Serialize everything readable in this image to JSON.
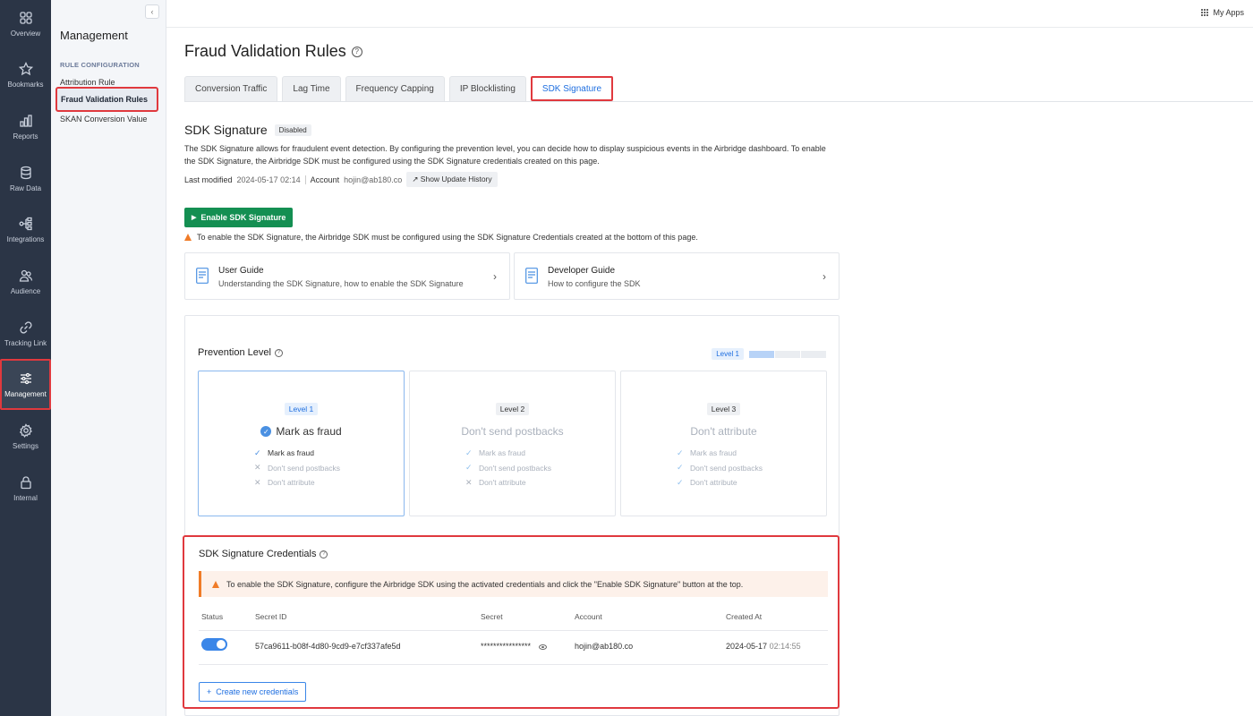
{
  "rail": {
    "items": [
      {
        "label": "Overview",
        "icon": "grid-icon"
      },
      {
        "label": "Bookmarks",
        "icon": "star-icon"
      },
      {
        "label": "Reports",
        "icon": "bar-chart-icon"
      },
      {
        "label": "Raw Data",
        "icon": "database-icon"
      },
      {
        "label": "Integrations",
        "icon": "integrations-icon"
      },
      {
        "label": "Audience",
        "icon": "audience-icon"
      },
      {
        "label": "Tracking Link",
        "icon": "link-icon"
      },
      {
        "label": "Management",
        "icon": "sliders-icon"
      },
      {
        "label": "Settings",
        "icon": "gear-icon"
      },
      {
        "label": "Internal",
        "icon": "lock-icon"
      }
    ]
  },
  "subnav": {
    "collapse": "‹",
    "title": "Management",
    "section": "RULE CONFIGURATION",
    "links": [
      "Attribution Rule",
      "Fraud Validation Rules",
      "SKAN Conversion Value"
    ]
  },
  "topbar": {
    "myapps": "My Apps"
  },
  "page": {
    "title": "Fraud Validation Rules",
    "help": "?"
  },
  "tabs": [
    "Conversion Traffic",
    "Lag Time",
    "Frequency Capping",
    "IP Blocklisting",
    "SDK Signature"
  ],
  "sdk": {
    "title": "SDK Signature",
    "status": "Disabled",
    "description": "The SDK Signature allows for fraudulent event detection. By configuring the prevention level, you can decide how to display suspicious events in the Airbridge dashboard. To enable the SDK Signature, the Airbridge SDK must be configured using the SDK Signature credentials created on this page.",
    "last_modified_label": "Last modified",
    "last_modified": "2024-05-17 02:14",
    "account_label": "Account",
    "account": "hojin@ab180.co",
    "history_btn": "↗ Show Update History",
    "enable_btn": "Enable SDK Signature",
    "enable_warning": "To enable the SDK Signature, the Airbridge SDK must be configured using the SDK Signature Credentials created at the bottom of this page."
  },
  "guides": [
    {
      "title": "User Guide",
      "subtitle": "Understanding the SDK Signature, how to enable the SDK Signature"
    },
    {
      "title": "Developer Guide",
      "subtitle": "How to configure the SDK"
    }
  ],
  "prevention": {
    "title": "Prevention Level",
    "current": "Level 1",
    "current_level": 1,
    "max_level": 3,
    "cards": [
      {
        "level": "Level 1",
        "title": "Mark as fraud",
        "selected": true,
        "items": [
          {
            "text": "Mark as fraud",
            "on": true
          },
          {
            "text": "Don't send postbacks",
            "on": false
          },
          {
            "text": "Don't attribute",
            "on": false
          }
        ]
      },
      {
        "level": "Level 2",
        "title": "Don't send postbacks",
        "selected": false,
        "items": [
          {
            "text": "Mark as fraud",
            "on": true
          },
          {
            "text": "Don't send postbacks",
            "on": true
          },
          {
            "text": "Don't attribute",
            "on": false
          }
        ]
      },
      {
        "level": "Level 3",
        "title": "Don't attribute",
        "selected": false,
        "items": [
          {
            "text": "Mark as fraud",
            "on": true
          },
          {
            "text": "Don't send postbacks",
            "on": true
          },
          {
            "text": "Don't attribute",
            "on": true
          }
        ]
      }
    ]
  },
  "credentials": {
    "title": "SDK Signature Credentials",
    "warning": "To enable the SDK Signature, configure the Airbridge SDK using the activated credentials and click the \"Enable SDK Signature\" button at the top.",
    "headers": [
      "Status",
      "Secret ID",
      "Secret",
      "Account",
      "Created At"
    ],
    "row": {
      "status_on": true,
      "secret_id": "57ca9611-b08f-4d80-9cd9-e7cf337afe5d",
      "secret": "****************",
      "account": "hojin@ab180.co",
      "created_date": "2024-05-17",
      "created_time": "02:14:55"
    },
    "new_btn": "Create new credentials"
  }
}
